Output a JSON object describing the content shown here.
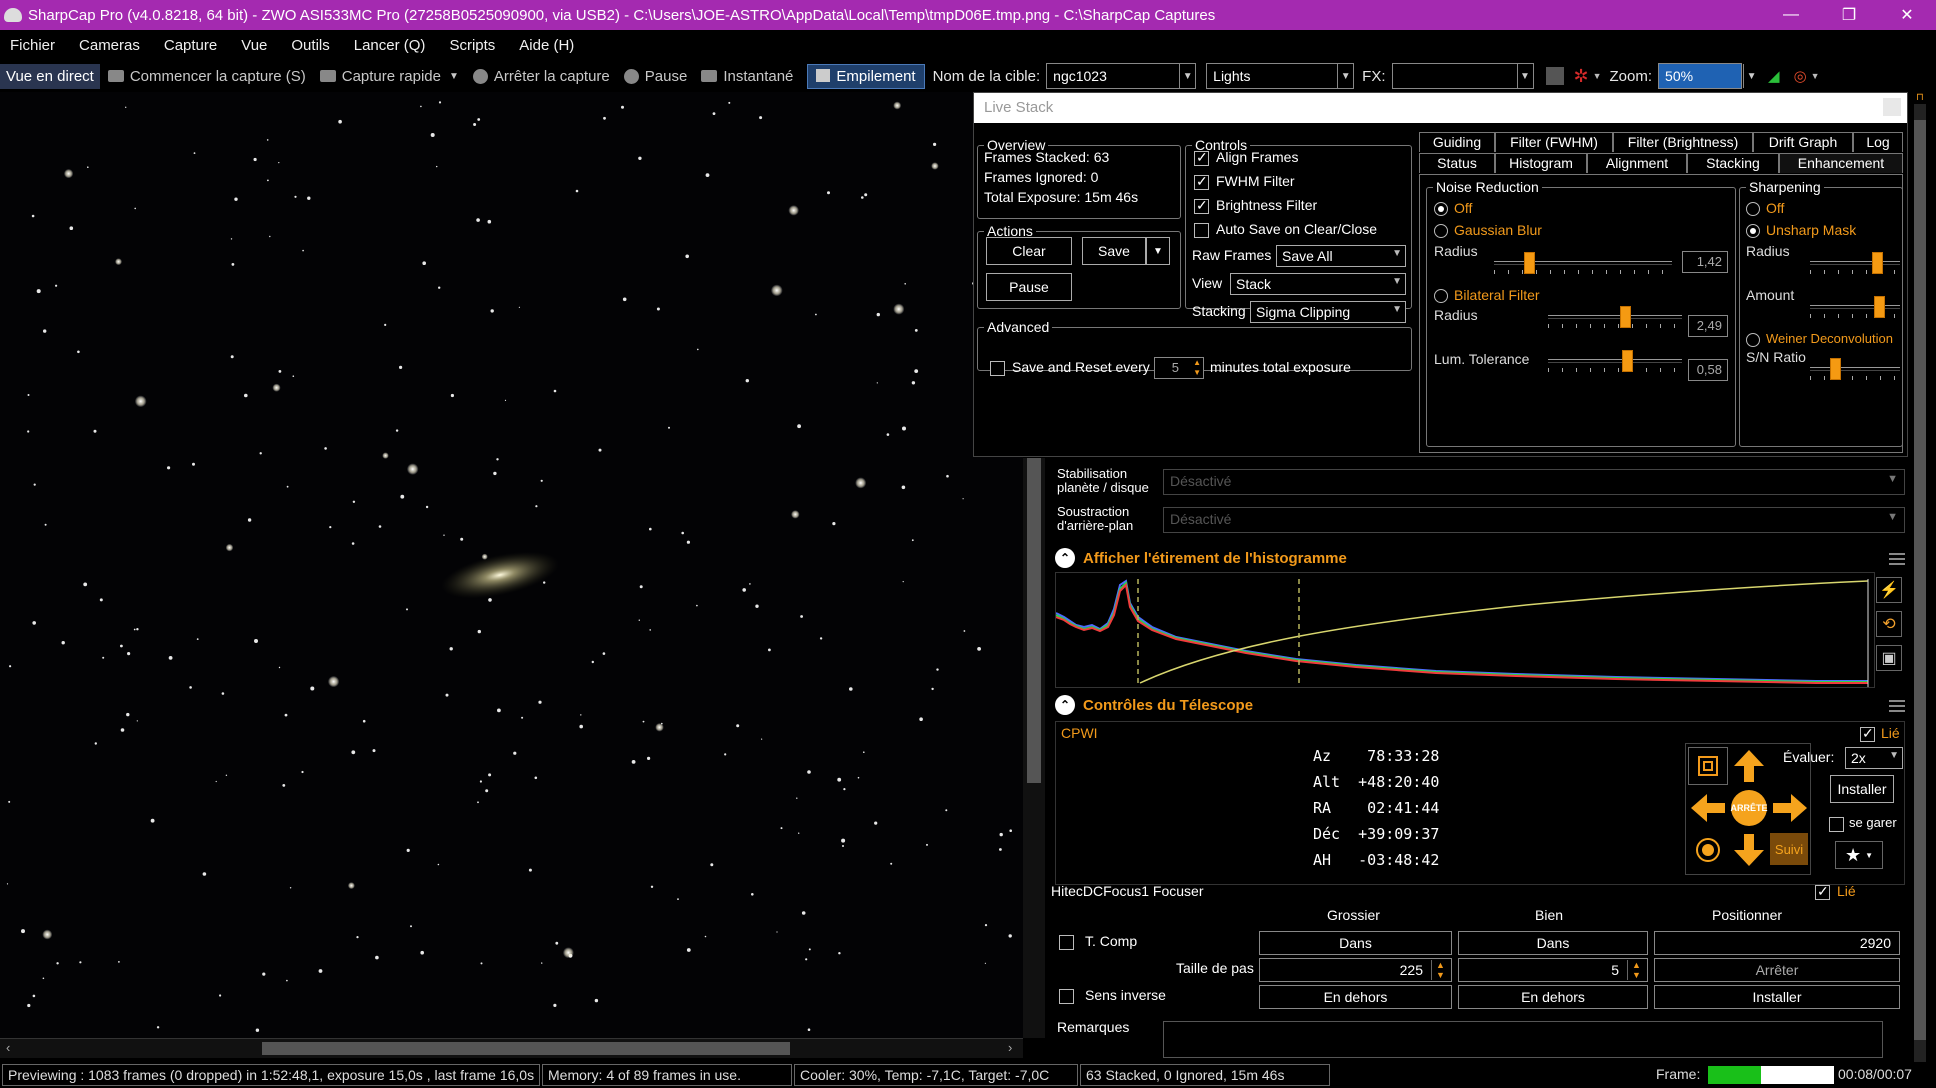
{
  "titlebar": {
    "title": "SharpCap Pro (v4.0.8218, 64 bit) - ZWO ASI533MC Pro (27258B0525090900, via USB2) - C:\\Users\\JOE-ASTRO\\AppData\\Local\\Temp\\tmpD06E.tmp.png - C:\\SharpCap Captures",
    "minimize": "—",
    "restore": "❐",
    "close": "✕"
  },
  "menu": [
    "Fichier",
    "Cameras",
    "Capture",
    "Vue",
    "Outils",
    "Lancer (Q)",
    "Scripts",
    "Aide (H)"
  ],
  "toolbar": {
    "live_view": "Vue en direct",
    "start_capture": "Commencer la capture (S)",
    "quick_capture": "Capture rapide",
    "stop_capture": "Arrêter la capture",
    "pause": "Pause",
    "snapshot": "Instantané",
    "stacking": "Empilement",
    "target_label": "Nom de la cible:",
    "target_value": "ngc1023",
    "frame_type": "Lights",
    "fx_label": "FX:",
    "fx_value": "",
    "zoom_label": "Zoom:",
    "zoom_value": "50%"
  },
  "livestack": {
    "header": "Live Stack",
    "overview": {
      "legend": "Overview",
      "frames_stacked": "Frames Stacked: 63",
      "frames_ignored": "Frames Ignored:  0",
      "total_exposure": "Total Exposure:   15m 46s"
    },
    "actions": {
      "legend": "Actions",
      "clear": "Clear",
      "save": "Save",
      "pause": "Pause"
    },
    "advanced": {
      "legend": "Advanced",
      "save_reset": "Save and Reset every",
      "minutes_value": "5",
      "minutes_label": "minutes total exposure"
    },
    "controls": {
      "legend": "Controls",
      "align_frames": "Align Frames",
      "fwhm_filter": "FWHM Filter",
      "brightness_filter": "Brightness Filter",
      "auto_save": "Auto Save on Clear/Close",
      "raw_frames_label": "Raw Frames",
      "raw_frames_value": "Save All",
      "view_label": "View",
      "view_value": "Stack",
      "stacking_label": "Stacking",
      "stacking_value": "Sigma Clipping"
    },
    "tabs_row1": [
      "Guiding",
      "Filter (FWHM)",
      "Filter (Brightness)",
      "Drift Graph",
      "Log"
    ],
    "tabs_row2": [
      "Status",
      "Histogram",
      "Alignment",
      "Stacking",
      "Enhancement"
    ],
    "noise": {
      "legend": "Noise Reduction",
      "off": "Off",
      "gaussian": "Gaussian Blur",
      "radius1": "Radius",
      "radius1_value": "1,42",
      "bilateral": "Bilateral Filter",
      "radius2": "Radius",
      "radius2_value": "2,49",
      "lum_tol": "Lum. Tolerance",
      "lum_tol_value": "0,58"
    },
    "sharpening": {
      "legend": "Sharpening",
      "off": "Off",
      "unsharp": "Unsharp Mask",
      "radius": "Radius",
      "amount": "Amount",
      "weiner": "Weiner Deconvolution",
      "sn_ratio": "S/N Ratio"
    }
  },
  "side": {
    "stab_label1": "Stabilisation",
    "stab_label2": "planète / disque",
    "stab_value": "Désactivé",
    "bg_label1": "Soustraction",
    "bg_label2": "d'arrière-plan",
    "bg_value": "Désactivé",
    "histogram_title": "Afficher l'étirement de l'histogramme",
    "telescope_title": "Contrôles du Télescope",
    "mount_name": "CPWI",
    "linked": "Lié",
    "az": "Az    78:33:28",
    "alt": "Alt  +48:20:40",
    "ra": "RA    02:41:44",
    "dec": "Déc  +39:09:37",
    "ah": "AH   -03:48:42",
    "evaluer_label": "Évaluer:",
    "evaluer_value": "2x",
    "installer": "Installer",
    "park": "se garer",
    "stop": "ARRÊTE",
    "track": "Suivi",
    "focuser_name": "HitecDCFocus1 Focuser",
    "focuser_linked": "Lié",
    "coarse": "Grossier",
    "fine": "Bien",
    "position": "Positionner",
    "tcomp": "T. Comp",
    "in1": "Dans",
    "in2": "Dans",
    "position_value": "2920",
    "step_label": "Taille de pas",
    "step_coarse": "225",
    "step_fine": "5",
    "stop_focus": "Arrêter",
    "reverse": "Sens inverse",
    "out1": "En dehors",
    "out2": "En dehors",
    "install_focus": "Installer",
    "notes": "Remarques"
  },
  "status": {
    "preview": "Previewing : 1083 frames (0 dropped) in 1:52:48,1, exposure 15,0s , last frame 16,0s",
    "memory": "Memory: 4 of 89 frames in use.",
    "cooler": "Cooler: 30%, Temp: -7,1C, Target: -7,0C",
    "stacked": "63 Stacked, 0 Ignored, 15m 46s",
    "frame_label": "Frame:",
    "frame_progress": 0.42,
    "frame_time": "00:08/00:07"
  },
  "colors": {
    "title_bar": "#a42ab0",
    "accent_orange": "#f29a1b",
    "progress_green": "#19c019"
  }
}
